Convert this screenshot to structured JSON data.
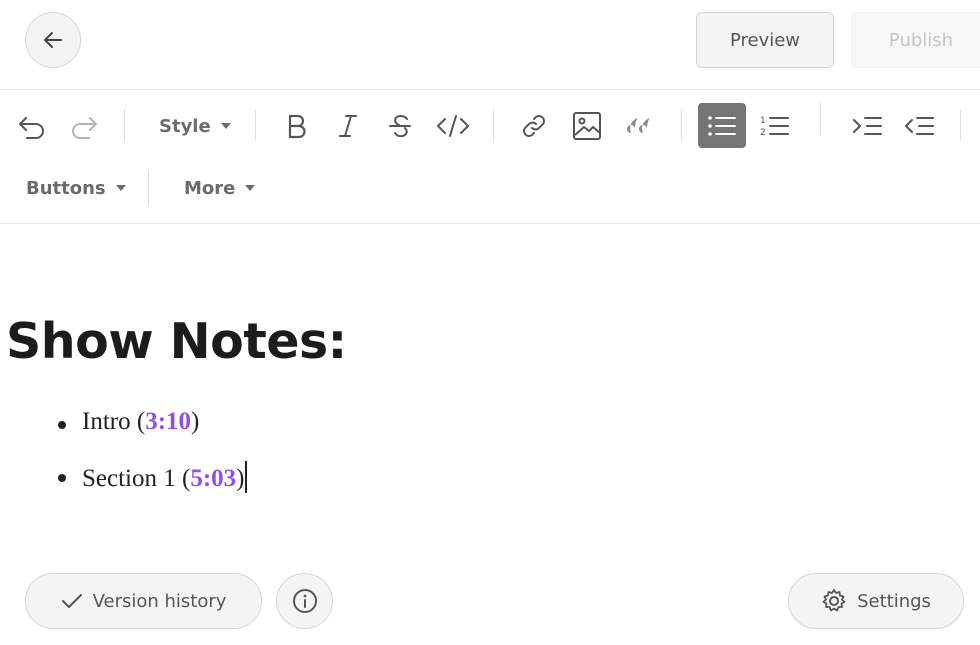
{
  "header": {
    "back_icon": "arrow-left-icon",
    "preview_label": "Preview",
    "publish_label": "Publish"
  },
  "toolbar": {
    "row1": {
      "undo_icon": "undo-icon",
      "redo_icon": "redo-icon",
      "style_label": "Style",
      "bold_icon": "bold-icon",
      "italic_icon": "italic-icon",
      "strikethrough_icon": "strikethrough-icon",
      "code_icon": "code-icon",
      "link_icon": "link-icon",
      "image_icon": "image-icon",
      "quote_icon": "quote-icon",
      "bullet_list_icon": "bullet-list-icon",
      "numbered_list_icon": "numbered-list-icon",
      "indent_icon": "indent-icon",
      "outdent_icon": "outdent-icon"
    },
    "row2": {
      "buttons_label": "Buttons",
      "more_label": "More"
    },
    "active_tool": "bullet-list"
  },
  "editor": {
    "heading": "Show Notes:",
    "items": [
      {
        "text": "Intro",
        "timestamp": "3:10"
      },
      {
        "text": "Section 1",
        "timestamp": "5:03"
      }
    ],
    "timestamp_color": "#8f4ff0"
  },
  "footer": {
    "version_history_label": "Version history",
    "info_icon": "info-icon",
    "settings_label": "Settings"
  }
}
